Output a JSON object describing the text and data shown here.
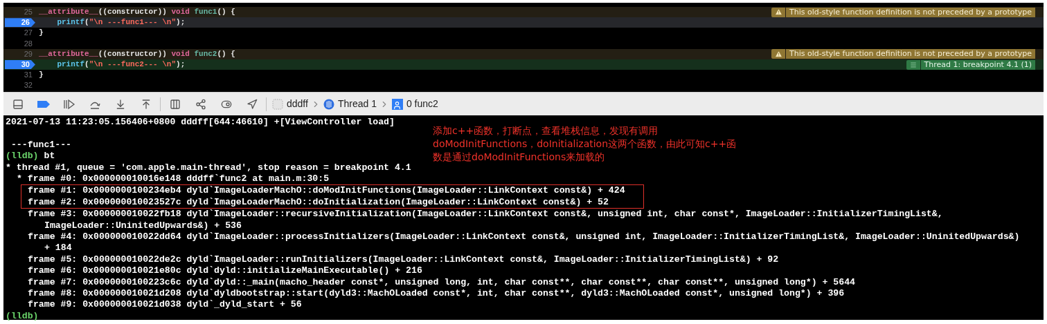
{
  "editor": {
    "lines": [
      {
        "number": "25",
        "kind": "warning",
        "breakpoint": false,
        "tokens": [
          {
            "kind": "keyword",
            "text": "__attribute__"
          },
          {
            "kind": "plain",
            "text": "((constructor)) "
          },
          {
            "kind": "keyword",
            "text": "void "
          },
          {
            "kind": "function",
            "text": "func1"
          },
          {
            "kind": "plain",
            "text": "() {"
          }
        ],
        "badge": {
          "kind": "warning",
          "text": "This old-style function definition is not preceded by a prototype"
        }
      },
      {
        "number": "26",
        "kind": "current",
        "breakpoint": true,
        "tokens": [
          {
            "kind": "call",
            "text": "    printf"
          },
          {
            "kind": "plain",
            "text": "("
          },
          {
            "kind": "string",
            "text": "\"\\n ---func1--- \\n\""
          },
          {
            "kind": "plain",
            "text": ");"
          }
        ]
      },
      {
        "number": "27",
        "kind": "plain",
        "breakpoint": false,
        "tokens": [
          {
            "kind": "plain",
            "text": "}"
          }
        ]
      },
      {
        "number": "28",
        "kind": "plain",
        "breakpoint": false
      },
      {
        "number": "29",
        "kind": "warning",
        "breakpoint": false,
        "tokens": [
          {
            "kind": "keyword",
            "text": "__attribute__"
          },
          {
            "kind": "plain",
            "text": "((constructor)) "
          },
          {
            "kind": "keyword",
            "text": "void "
          },
          {
            "kind": "function",
            "text": "func2"
          },
          {
            "kind": "plain",
            "text": "() {"
          }
        ],
        "badge": {
          "kind": "warning",
          "text": "This old-style function definition is not preceded by a prototype"
        }
      },
      {
        "number": "30",
        "kind": "thread",
        "breakpoint": true,
        "tokens": [
          {
            "kind": "call",
            "text": "    printf"
          },
          {
            "kind": "plain",
            "text": "("
          },
          {
            "kind": "string",
            "text": "\"\\n ---func2--- \\n\""
          },
          {
            "kind": "plain",
            "text": ");"
          }
        ],
        "badge": {
          "kind": "thread",
          "text": "Thread 1: breakpoint 4.1 (1)"
        }
      },
      {
        "number": "31",
        "kind": "plain",
        "breakpoint": false,
        "tokens": [
          {
            "kind": "plain",
            "text": "}"
          }
        ]
      },
      {
        "number": "32",
        "kind": "plain",
        "breakpoint": false
      }
    ]
  },
  "toolbar": {
    "buttons": [
      {
        "kind": "console",
        "active": false
      },
      {
        "kind": "breakpoints",
        "active": true
      },
      {
        "kind": "continue",
        "active": false
      },
      {
        "kind": "step-over",
        "active": false
      },
      {
        "kind": "step-into",
        "active": false
      },
      {
        "kind": "step-out",
        "active": false
      },
      {
        "kind": "view-debugger",
        "active": false
      },
      {
        "kind": "memory-graph",
        "active": false
      },
      {
        "kind": "environment",
        "active": false
      },
      {
        "kind": "location",
        "active": false
      }
    ],
    "breadcrumbs": [
      {
        "kind": "app",
        "label": "dddff"
      },
      {
        "kind": "thread",
        "label": "Thread 1"
      },
      {
        "kind": "frame",
        "label": "0 func2"
      }
    ]
  },
  "console": {
    "lines": [
      {
        "kind": "output",
        "text": "2021-07-13 11:23:05.156406+0800 dddff[644:46610] +[ViewController load]"
      },
      {
        "kind": "blank"
      },
      {
        "kind": "output",
        "text": " ---func1---"
      },
      {
        "kind": "prompt",
        "prompt": "(lldb)",
        "command": "bt"
      },
      {
        "kind": "output",
        "text": "* thread #1, queue = 'com.apple.main-thread', stop reason = breakpoint 4.1"
      },
      {
        "kind": "current-frame",
        "text": "* frame #0: 0x000000010016e148 dddff`func2 at main.m:30:5"
      },
      {
        "kind": "boxed-group",
        "frames": [
          "frame #1: 0x0000000100234eb4 dyld`ImageLoaderMachO::doModInitFunctions(ImageLoader::LinkContext const&) + 424",
          "frame #2: 0x000000010023527c dyld`ImageLoaderMachO::doInitialization(ImageLoader::LinkContext const&) + 52"
        ]
      },
      {
        "kind": "frame",
        "text": "frame #3: 0x000000010022fb18 dyld`ImageLoader::recursiveInitialization(ImageLoader::LinkContext const&, unsigned int, char const*, ImageLoader::InitializerTimingList&, ImageLoader::UninitedUpwards&) + 536"
      },
      {
        "kind": "frame",
        "text": "frame #4: 0x000000010022dd64 dyld`ImageLoader::processInitializers(ImageLoader::LinkContext const&, unsigned int, ImageLoader::InitializerTimingList&, ImageLoader::UninitedUpwards&) + 184"
      },
      {
        "kind": "frame",
        "text": "frame #5: 0x000000010022de2c dyld`ImageLoader::runInitializers(ImageLoader::LinkContext const&, ImageLoader::InitializerTimingList&) + 92"
      },
      {
        "kind": "frame",
        "text": "frame #6: 0x000000010021e80c dyld`dyld::initializeMainExecutable() + 216"
      },
      {
        "kind": "frame",
        "text": "frame #7: 0x0000000100223c6c dyld`dyld::_main(macho_header const*, unsigned long, int, char const**, char const**, char const**, unsigned long*) + 5644"
      },
      {
        "kind": "frame",
        "text": "frame #8: 0x000000010021d208 dyld`dyldbootstrap::start(dyld3::MachOLoaded const*, int, char const**, dyld3::MachOLoaded const*, unsigned long*) + 396"
      },
      {
        "kind": "frame",
        "text": "frame #9: 0x000000010021d038 dyld`_dyld_start + 56"
      },
      {
        "kind": "prompt",
        "prompt": "(lldb)"
      }
    ]
  },
  "annotation": {
    "text": "添加c++函数，打断点，查看堆栈信息，发现有调用doModInitFunctions，doInitialization这两个函数，由此可知c++函数是通过doModInitFunctions来加载的"
  }
}
